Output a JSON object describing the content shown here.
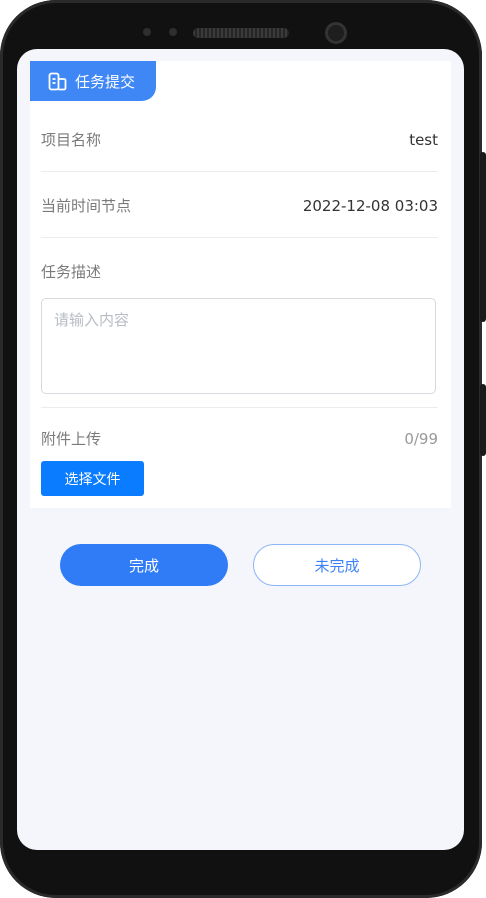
{
  "header": {
    "title": "任务提交",
    "icon": "document-icon"
  },
  "fields": {
    "project_name": {
      "label": "项目名称",
      "value": "test"
    },
    "time_node": {
      "label": "当前时间节点",
      "value": "2022-12-08 03:03"
    },
    "description": {
      "label": "任务描述",
      "placeholder": "请输入内容",
      "value": ""
    },
    "attachment": {
      "label": "附件上传",
      "count": "0/99",
      "button_label": "选择文件"
    }
  },
  "actions": {
    "done_label": "完成",
    "undone_label": "未完成"
  },
  "colors": {
    "accent": "#2f7cf6",
    "header_bg": "#3f87f5",
    "screen_bg": "#f4f6fb"
  }
}
